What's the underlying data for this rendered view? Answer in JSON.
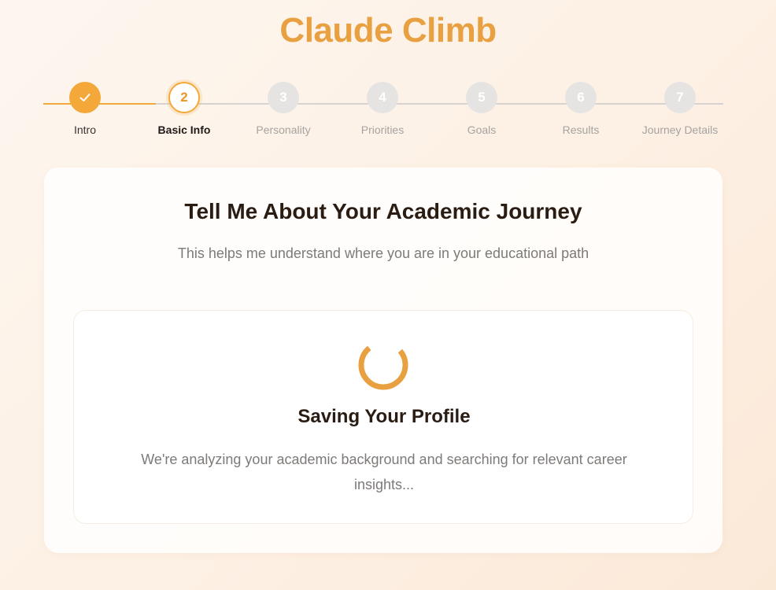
{
  "app": {
    "title": "Claude Climb"
  },
  "stepper": {
    "steps": [
      {
        "number": "1",
        "label": "Intro",
        "state": "done"
      },
      {
        "number": "2",
        "label": "Basic Info",
        "state": "active"
      },
      {
        "number": "3",
        "label": "Personality",
        "state": "pending"
      },
      {
        "number": "4",
        "label": "Priorities",
        "state": "pending"
      },
      {
        "number": "5",
        "label": "Goals",
        "state": "pending"
      },
      {
        "number": "6",
        "label": "Results",
        "state": "pending"
      },
      {
        "number": "7",
        "label": "Journey Details",
        "state": "pending"
      }
    ]
  },
  "card": {
    "title": "Tell Me About Your Academic Journey",
    "subtitle": "This helps me understand where you are in your educational path"
  },
  "loader": {
    "title": "Saving Your Profile",
    "message": "We're analyzing your academic background and searching for relevant career insights..."
  },
  "colors": {
    "accent": "#f5a83a",
    "title": "#e8a040",
    "heading": "#2a1c12",
    "muted": "#7d7a78"
  },
  "icons": {
    "done_step": "check-icon",
    "loading": "loading-spinner-icon"
  }
}
